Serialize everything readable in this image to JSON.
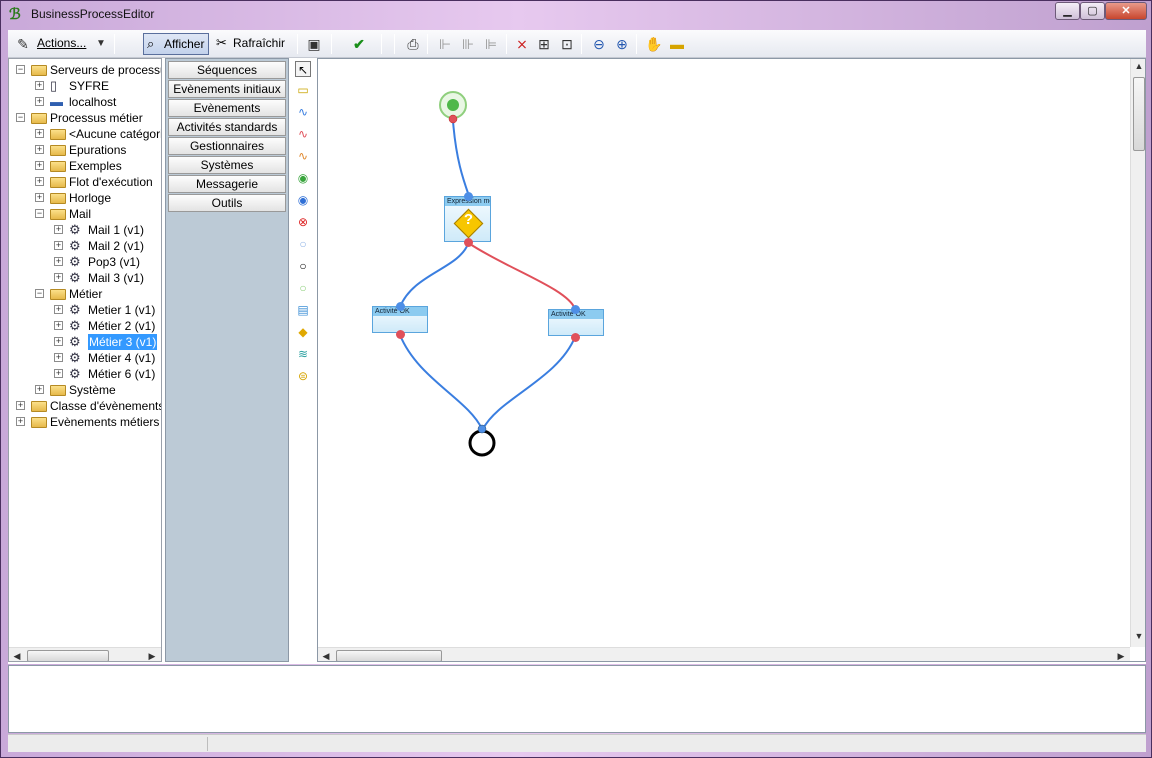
{
  "window": {
    "title": "BusinessProcessEditor"
  },
  "toolbar": {
    "actions_label": "Actions...",
    "show_label": "Afficher",
    "refresh_label": "Rafraîchir"
  },
  "tree": [
    {
      "label": "Serveurs de processus",
      "level": 0,
      "exp": "-",
      "icon": "folder"
    },
    {
      "label": "SYFRE",
      "level": 1,
      "exp": "+",
      "icon": "server"
    },
    {
      "label": "localhost",
      "level": 1,
      "exp": "+",
      "icon": "computer"
    },
    {
      "label": "Processus métier",
      "level": 0,
      "exp": "-",
      "icon": "folder"
    },
    {
      "label": "<Aucune catégorie",
      "level": 1,
      "exp": "+",
      "icon": "folder"
    },
    {
      "label": "Epurations",
      "level": 1,
      "exp": "+",
      "icon": "folder"
    },
    {
      "label": "Exemples",
      "level": 1,
      "exp": "+",
      "icon": "folder"
    },
    {
      "label": "Flot d'exécution",
      "level": 1,
      "exp": "+",
      "icon": "folder"
    },
    {
      "label": "Horloge",
      "level": 1,
      "exp": "+",
      "icon": "folder"
    },
    {
      "label": "Mail",
      "level": 1,
      "exp": "-",
      "icon": "folder"
    },
    {
      "label": "Mail 1 (v1)",
      "level": 2,
      "exp": "+",
      "icon": "process"
    },
    {
      "label": "Mail 2 (v1)",
      "level": 2,
      "exp": "+",
      "icon": "process"
    },
    {
      "label": "Pop3 (v1)",
      "level": 2,
      "exp": "+",
      "icon": "process"
    },
    {
      "label": "Mail 3 (v1)",
      "level": 2,
      "exp": "+",
      "icon": "process"
    },
    {
      "label": "Métier",
      "level": 1,
      "exp": "-",
      "icon": "folder"
    },
    {
      "label": "Metier 1 (v1)",
      "level": 2,
      "exp": "+",
      "icon": "process"
    },
    {
      "label": "Métier 2 (v1)",
      "level": 2,
      "exp": "+",
      "icon": "process"
    },
    {
      "label": "Métier 3 (v1)",
      "level": 2,
      "exp": "+",
      "icon": "process",
      "selected": true
    },
    {
      "label": "Métier 4 (v1)",
      "level": 2,
      "exp": "+",
      "icon": "process"
    },
    {
      "label": "Métier 6 (v1)",
      "level": 2,
      "exp": "+",
      "icon": "process"
    },
    {
      "label": "Système",
      "level": 1,
      "exp": "+",
      "icon": "folder"
    },
    {
      "label": "Classe d'évènements r",
      "level": 0,
      "exp": "+",
      "icon": "folder"
    },
    {
      "label": "Evènements métiers",
      "level": 0,
      "exp": "+",
      "icon": "folder"
    }
  ],
  "categories": [
    "Séquences",
    "Evènements initiaux",
    "Evènements",
    "Activités standards",
    "Gestionnaires",
    "Systèmes",
    "Messagerie",
    "Outils"
  ],
  "diagram": {
    "decision_label": "Expression métier",
    "decision_symbol": "?",
    "activity_left_label": "Activité OK",
    "activity_right_label": "Activité OK"
  },
  "colors": {
    "selection": "#3399ff",
    "link_true": "#3a7ee0",
    "link_false": "#e0505a"
  }
}
